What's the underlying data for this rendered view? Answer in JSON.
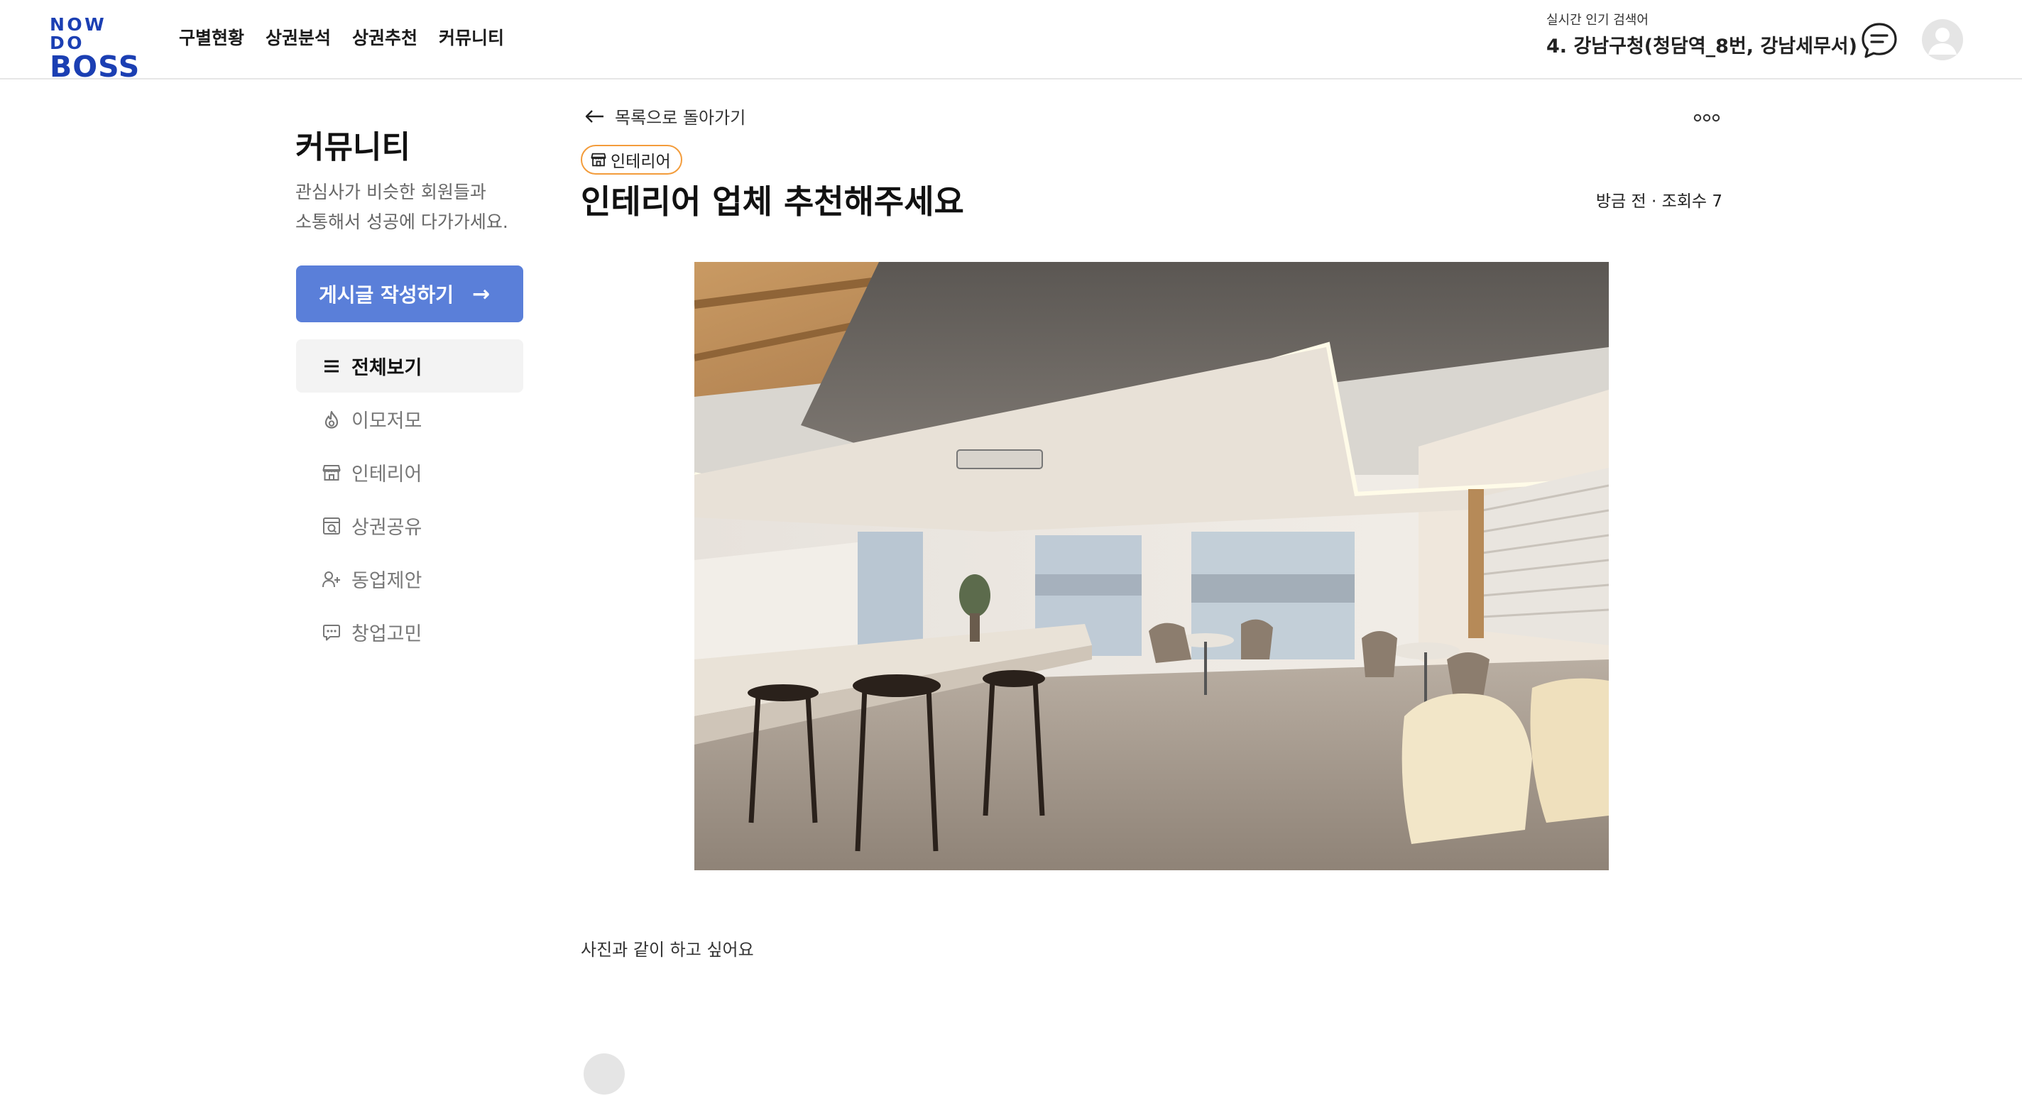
{
  "logo": {
    "line1": "NOW DO",
    "line2": "BOSS"
  },
  "nav": [
    "구별현황",
    "상권분석",
    "상권추천",
    "커뮤니티"
  ],
  "trending": {
    "caption": "실시간 인기 검색어",
    "keyword": "4. 강남구청(청담역_8번, 강남세무서)"
  },
  "header_icons": {
    "chat": "chat-bubble-icon",
    "avatar": "user-avatar-icon"
  },
  "sidebar": {
    "title": "커뮤니티",
    "description_line1": "관심사가 비슷한 회원들과",
    "description_line2": "소통해서 성공에 다가가세요.",
    "write_button": "게시글 작성하기",
    "menu": [
      {
        "label": "전체보기",
        "icon": "list-icon",
        "active": true
      },
      {
        "label": "이모저모",
        "icon": "flame-icon",
        "active": false
      },
      {
        "label": "인테리어",
        "icon": "storefront-icon",
        "active": false
      },
      {
        "label": "상권공유",
        "icon": "map-share-icon",
        "active": false
      },
      {
        "label": "동업제안",
        "icon": "user-plus-icon",
        "active": false
      },
      {
        "label": "창업고민",
        "icon": "chat-dots-icon",
        "active": false
      }
    ]
  },
  "post": {
    "back_label": "목록으로 돌아가기",
    "category": "인테리어",
    "title": "인테리어 업체 추천해주세요",
    "meta": "방금 전 · 조회수 7",
    "image": "cafe-interior-photo",
    "body": "사진과 같이 하고 싶어요"
  },
  "colors": {
    "brand": "#1b3fb3",
    "primary_button": "#5a7fd9",
    "tag_border": "#f39c3b",
    "active_menu_bg": "#f3f3f3"
  }
}
